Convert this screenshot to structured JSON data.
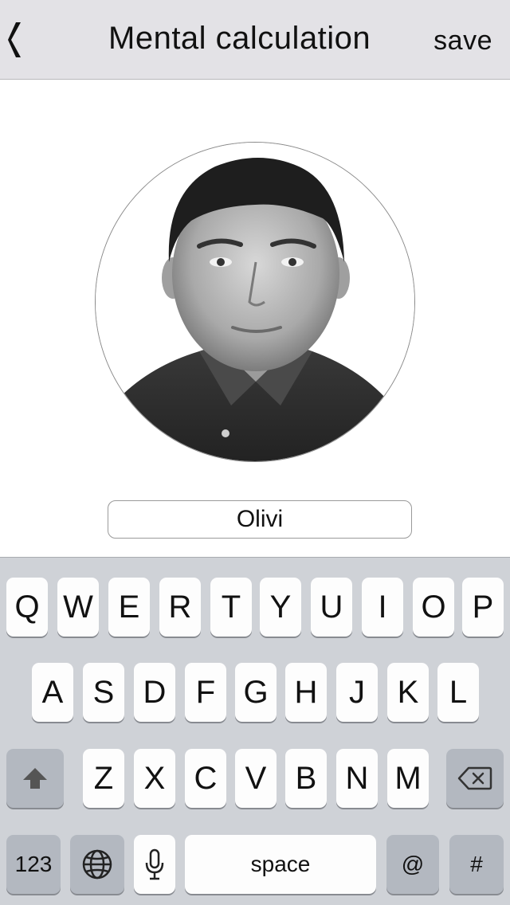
{
  "navbar": {
    "back_icon": "back-chevron-icon",
    "title": "Mental calculation",
    "save_label": "save"
  },
  "profile": {
    "photo_icon": "person-portrait-photo",
    "name_value": "Olivi"
  },
  "keyboard": {
    "row1": [
      "Q",
      "W",
      "E",
      "R",
      "T",
      "Y",
      "U",
      "I",
      "O",
      "P"
    ],
    "row2": [
      "A",
      "S",
      "D",
      "F",
      "G",
      "H",
      "J",
      "K",
      "L"
    ],
    "row3": [
      "Z",
      "X",
      "C",
      "V",
      "B",
      "N",
      "M"
    ],
    "shift_icon": "shift-arrow-icon",
    "delete_icon": "delete-backspace-icon",
    "numbers_label": "123",
    "globe_icon": "globe-icon",
    "mic_icon": "microphone-icon",
    "space_label": "space",
    "at_label": "@",
    "hash_label": "#"
  }
}
